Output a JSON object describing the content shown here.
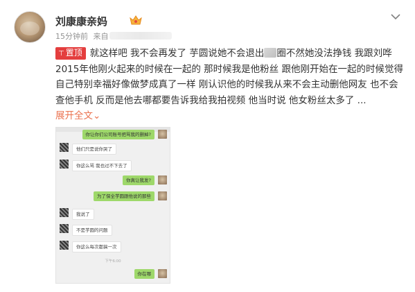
{
  "post": {
    "username": "刘康康亲妈",
    "meta": {
      "time": "15分钟前",
      "source_prefix": "来自"
    },
    "pin_label": "置顶",
    "text_before_blur": "就这样吧 我不会再发了 芋圆说她不会退出",
    "text_after_blur": "圈不然她没法挣钱 我跟刘哗2015年他刚火起来的时候在一起的 那时候我是他粉丝 跟他刚开始在一起的时候觉得自己特别幸福好像做梦成真了一样 刚认识他的时候我从来不会主动删他网友 也不会查他手机 反而是他去哪都要告诉我给我拍视频 他当时说 他女粉丝太多了 ...",
    "expand_label": "展开全文",
    "expand_glyph": "⌄"
  },
  "chat": {
    "messages": [
      {
        "side": "right",
        "text": "你让你们公司账号把骂我的删掉?"
      },
      {
        "side": "left",
        "text": "他们只是说你哭了"
      },
      {
        "side": "left",
        "text": "你这么骂 我也过不下去了"
      },
      {
        "side": "right",
        "text": "你真让我发?"
      },
      {
        "side": "right",
        "text": "为了保全芋圆跟他说的那些"
      },
      {
        "side": "left",
        "text": "我说了"
      },
      {
        "side": "left",
        "text": "不是芋圆的问题"
      },
      {
        "side": "left",
        "text": "你这么每次都搞一次"
      },
      {
        "side": "right",
        "text": "你在哪"
      }
    ],
    "timestamp": "下午6:00"
  }
}
